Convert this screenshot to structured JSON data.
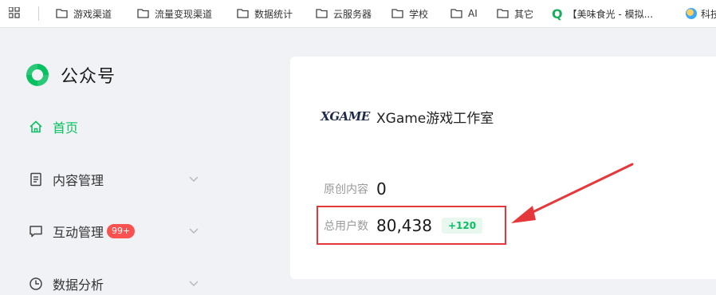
{
  "bookmarks": {
    "items": [
      {
        "label": "游戏渠道"
      },
      {
        "label": "流量变现渠道"
      },
      {
        "label": "数据统计"
      },
      {
        "label": "云服务器"
      },
      {
        "label": "学校"
      },
      {
        "label": "AI"
      },
      {
        "label": "其它"
      },
      {
        "label": "【美味食光 - 模拟..."
      },
      {
        "label": "科技"
      }
    ]
  },
  "sidebar": {
    "title": "公众号",
    "items": [
      {
        "label": "首页"
      },
      {
        "label": "内容管理"
      },
      {
        "label": "互动管理",
        "badge": "99+"
      },
      {
        "label": "数据分析"
      }
    ]
  },
  "account": {
    "logo_text": "XGAME",
    "name": "XGame游戏工作室"
  },
  "stats": {
    "original": {
      "label": "原创内容",
      "value": "0"
    },
    "users": {
      "label": "总用户数",
      "value": "80,438",
      "delta": "+120"
    }
  },
  "colors": {
    "accent": "#07c160",
    "highlight": "#e5383b",
    "badge": "#fa5151"
  }
}
